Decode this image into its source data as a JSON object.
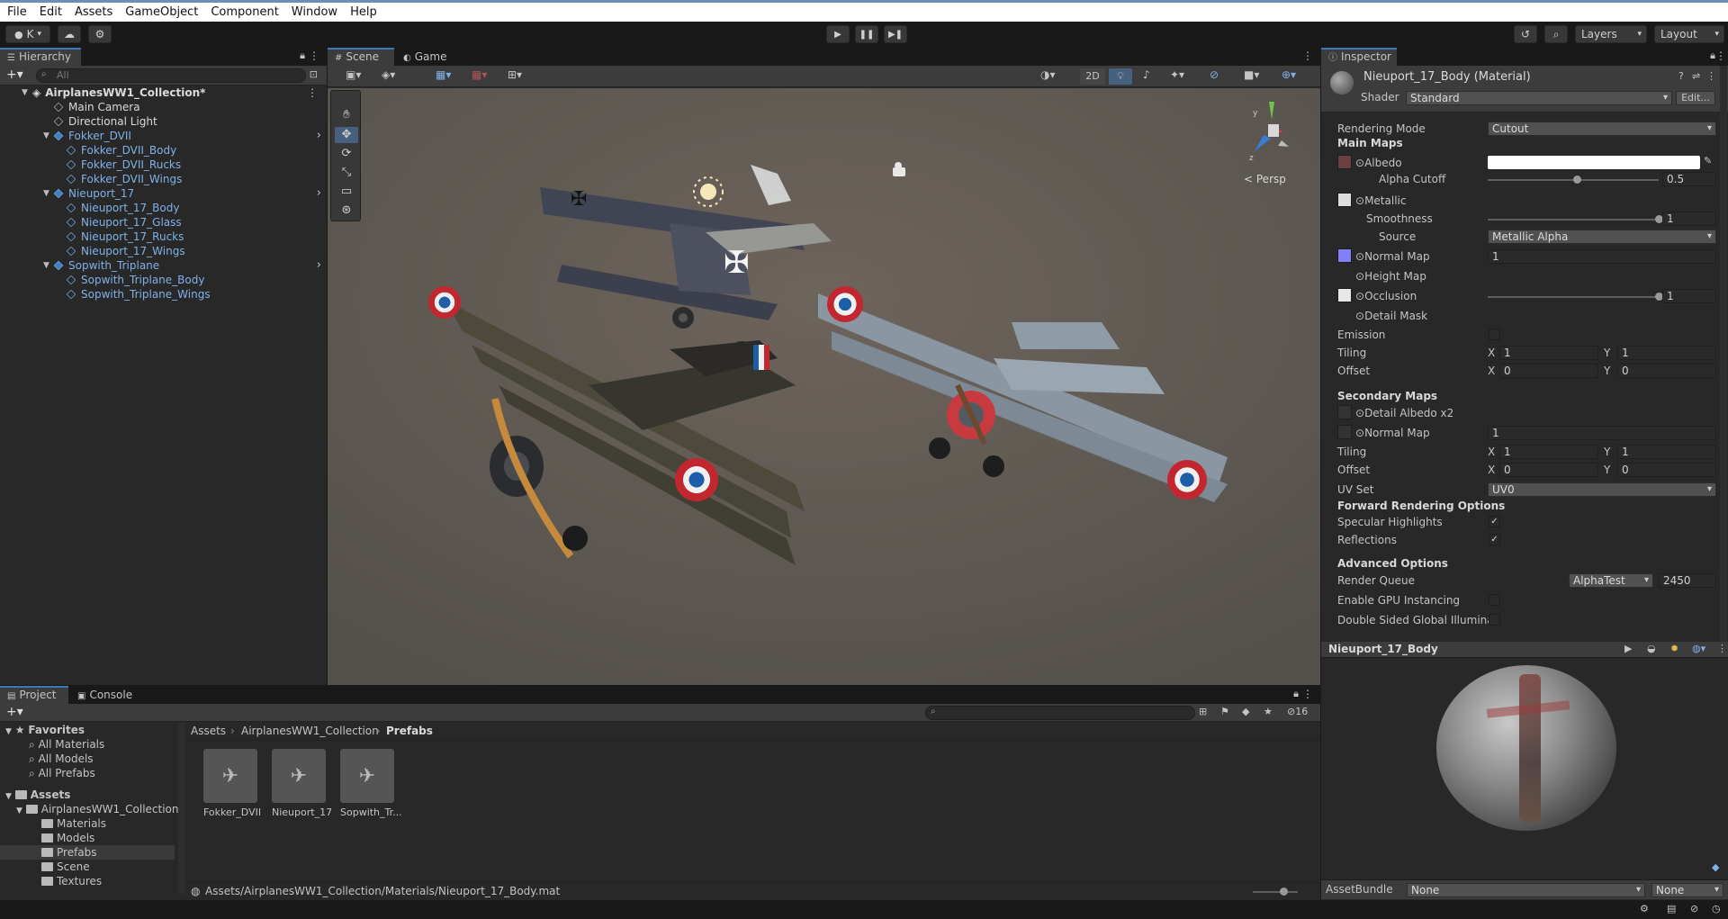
{
  "menu": [
    "File",
    "Edit",
    "Assets",
    "GameObject",
    "Component",
    "Window",
    "Help"
  ],
  "toolbar": {
    "account": "K",
    "layers": "Layers",
    "layout": "Layout"
  },
  "hierarchy": {
    "tab": "Hierarchy",
    "search_placeholder": "All",
    "items": [
      {
        "label": "AirplanesWW1_Collection*",
        "depth": 0,
        "kind": "scene"
      },
      {
        "label": "Main Camera",
        "depth": 1,
        "kind": "object"
      },
      {
        "label": "Directional Light",
        "depth": 1,
        "kind": "object"
      },
      {
        "label": "Fokker_DVII",
        "depth": 1,
        "kind": "prefab"
      },
      {
        "label": "Fokker_DVII_Body",
        "depth": 2,
        "kind": "child"
      },
      {
        "label": "Fokker_DVII_Rucks",
        "depth": 2,
        "kind": "child"
      },
      {
        "label": "Fokker_DVII_Wings",
        "depth": 2,
        "kind": "child"
      },
      {
        "label": "Nieuport_17",
        "depth": 1,
        "kind": "prefab"
      },
      {
        "label": "Nieuport_17_Body",
        "depth": 2,
        "kind": "child"
      },
      {
        "label": "Nieuport_17_Glass",
        "depth": 2,
        "kind": "child"
      },
      {
        "label": "Nieuport_17_Rucks",
        "depth": 2,
        "kind": "child"
      },
      {
        "label": "Nieuport_17_Wings",
        "depth": 2,
        "kind": "child"
      },
      {
        "label": "Sopwith_Triplane",
        "depth": 1,
        "kind": "prefab"
      },
      {
        "label": "Sopwith_Triplane_Body",
        "depth": 2,
        "kind": "child"
      },
      {
        "label": "Sopwith_Triplane_Wings",
        "depth": 2,
        "kind": "child"
      }
    ]
  },
  "scene": {
    "tab_scene": "Scene",
    "tab_game": "Game",
    "btn_2d": "2D",
    "persp": "Persp"
  },
  "inspector": {
    "tab": "Inspector",
    "title": "Nieuport_17_Body (Material)",
    "shader_label": "Shader",
    "shader_value": "Standard",
    "edit_button": "Edit...",
    "rendering_mode_label": "Rendering Mode",
    "rendering_mode_value": "Cutout",
    "main_maps": "Main Maps",
    "albedo": "Albedo",
    "alpha_cutoff": "Alpha Cutoff",
    "alpha_cutoff_value": "0.5",
    "metallic": "Metallic",
    "smoothness": "Smoothness",
    "smoothness_value": "1",
    "source": "Source",
    "source_value": "Metallic Alpha",
    "normal_map": "Normal Map",
    "normal_map_value": "1",
    "height_map": "Height Map",
    "occlusion": "Occlusion",
    "occlusion_value": "1",
    "detail_mask": "Detail Mask",
    "emission": "Emission",
    "tiling": "Tiling",
    "offset": "Offset",
    "x": "X",
    "y": "Y",
    "tiling_x": "1",
    "tiling_y": "1",
    "offset_x": "0",
    "offset_y": "0",
    "secondary_maps": "Secondary Maps",
    "detail_albedo": "Detail Albedo x2",
    "normal_map2": "Normal Map",
    "normal_map2_value": "1",
    "tiling2_x": "1",
    "tiling2_y": "1",
    "offset2_x": "0",
    "offset2_y": "0",
    "uv_set": "UV Set",
    "uv_set_value": "UV0",
    "forward_options": "Forward Rendering Options",
    "specular": "Specular Highlights",
    "reflections": "Reflections",
    "advanced": "Advanced Options",
    "render_queue": "Render Queue",
    "render_queue_mode": "AlphaTest",
    "render_queue_value": "2450",
    "gpu_instancing": "Enable GPU Instancing",
    "double_sided": "Double Sided Global Illuminat",
    "preview_title": "Nieuport_17_Body",
    "asset_bundle": "AssetBundle",
    "asset_bundle_value": "None",
    "asset_bundle_variant": "None"
  },
  "project": {
    "tab_project": "Project",
    "tab_console": "Console",
    "hidden_count": "16",
    "favorites": "Favorites",
    "fav_items": [
      "All Materials",
      "All Models",
      "All Prefabs"
    ],
    "assets": "Assets",
    "collection": "AirplanesWW1_Collection",
    "folders": [
      "Materials",
      "Models",
      "Prefabs",
      "Scene",
      "Textures"
    ],
    "breadcrumb": [
      "Assets",
      "AirplanesWW1_Collection",
      "Prefabs"
    ],
    "prefabs": [
      "Fokker_DVII",
      "Nieuport_17",
      "Sopwith_Tr..."
    ],
    "status_path": "Assets/AirplanesWW1_Collection/Materials/Nieuport_17_Body.mat"
  },
  "colors": {
    "accent": "#3a79bb",
    "prefab_text": "#7fb1e8",
    "scene_bg": "#605750",
    "normal_swatch": "#8080ff"
  }
}
